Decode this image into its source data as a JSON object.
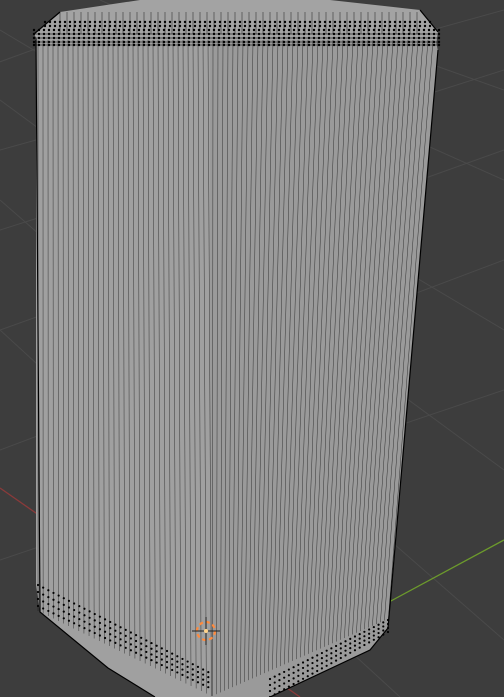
{
  "viewport": {
    "background_color": "#3d3d3d",
    "grid_color": "#4a4a4a",
    "x_axis_color": "#8a3a3a",
    "y_axis_color": "#6c9a2c",
    "object": {
      "type": "mesh",
      "mode": "edit",
      "face_color": "#9a9a9a",
      "edge_color": "#000000",
      "vertex_color": "#000000"
    },
    "cursor": {
      "icon": "3d-cursor-icon",
      "ring_color": "#ff8a3d"
    }
  }
}
